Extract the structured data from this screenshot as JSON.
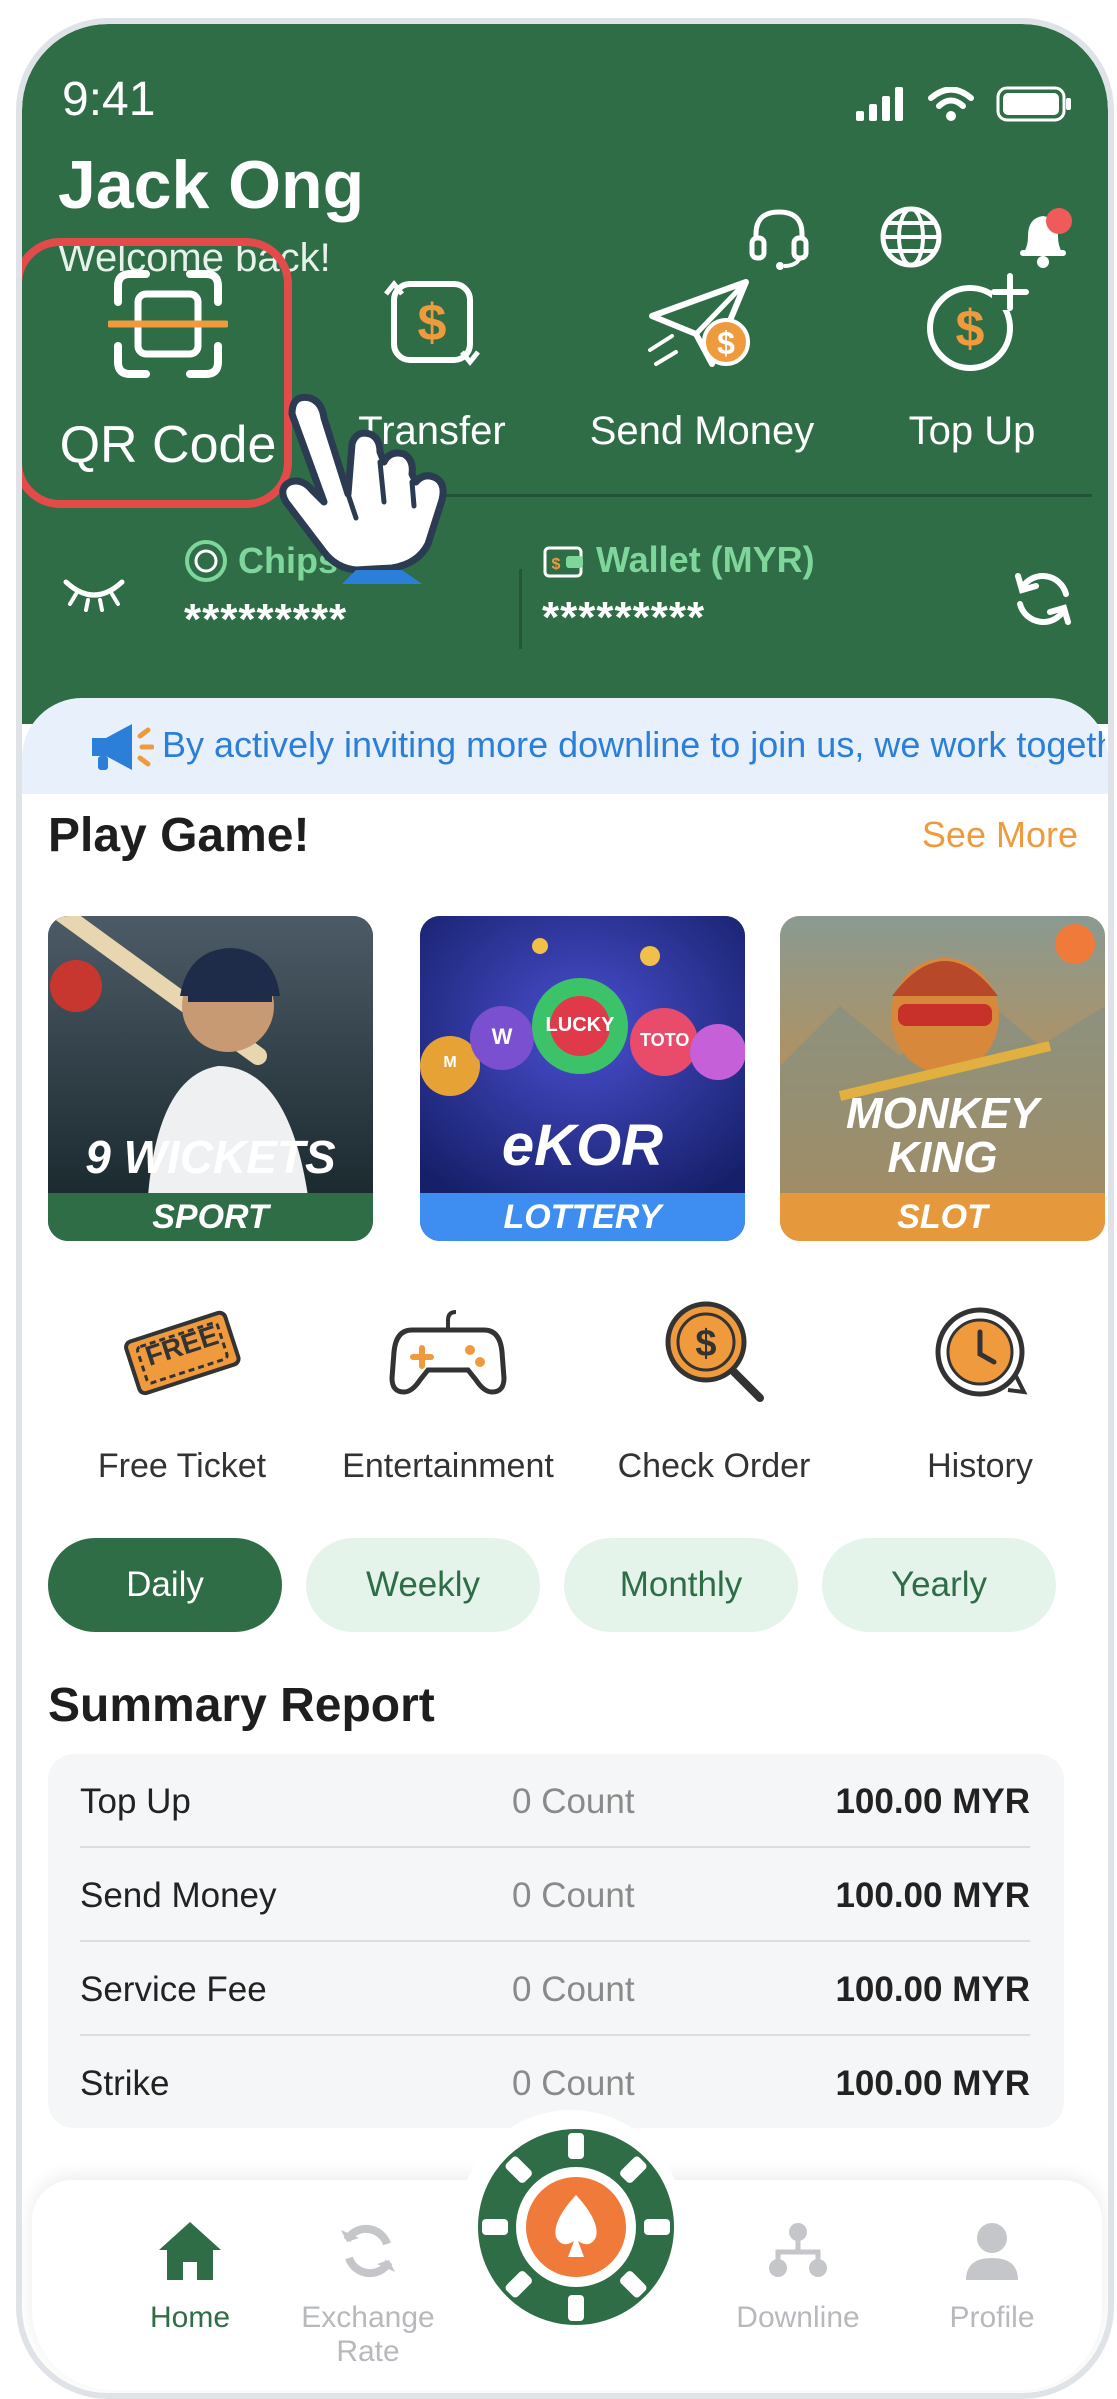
{
  "status": {
    "time": "9:41"
  },
  "user": {
    "name": "Jack Ong",
    "welcome": "Welcome back!"
  },
  "actions": [
    {
      "label": "QR Code",
      "icon": "qr-scan-icon"
    },
    {
      "label": "Transfer",
      "icon": "transfer-icon"
    },
    {
      "label": "Send Money",
      "icon": "send-money-icon"
    },
    {
      "label": "Top Up",
      "icon": "top-up-icon"
    }
  ],
  "balances": {
    "chips": {
      "label": "Chips",
      "value": "*********"
    },
    "wallet": {
      "label": "Wallet (MYR)",
      "value": "*********"
    }
  },
  "announcement": "By actively inviting more downline to join us, we work together",
  "play": {
    "title": "Play Game!",
    "see_more": "See More",
    "games": [
      {
        "name": "9 WICKETS",
        "category": "SPORT"
      },
      {
        "name": "eKOR",
        "category": "LOTTERY"
      },
      {
        "name": "MONKEY KING",
        "category": "SLOT"
      }
    ],
    "balls": [
      "M",
      "W",
      "LUCKY",
      "TOTO",
      ""
    ]
  },
  "tools": [
    {
      "label": "Free Ticket",
      "icon": "free-ticket-icon",
      "badge": "FREE"
    },
    {
      "label": "Entertainment",
      "icon": "gamepad-icon"
    },
    {
      "label": "Check Order",
      "icon": "check-order-icon"
    },
    {
      "label": "History",
      "icon": "history-icon"
    }
  ],
  "periods": [
    {
      "label": "Daily",
      "active": true
    },
    {
      "label": "Weekly",
      "active": false
    },
    {
      "label": "Monthly",
      "active": false
    },
    {
      "label": "Yearly",
      "active": false
    }
  ],
  "summary": {
    "title": "Summary Report",
    "rows": [
      {
        "name": "Top Up",
        "count": "0 Count",
        "amount": "100.00 MYR"
      },
      {
        "name": "Send Money",
        "count": "0 Count",
        "amount": "100.00 MYR"
      },
      {
        "name": "Service Fee",
        "count": "0 Count",
        "amount": "100.00 MYR"
      },
      {
        "name": "Strike",
        "count": "0 Count",
        "amount": "100.00 MYR"
      }
    ]
  },
  "nav": [
    {
      "label": "Home",
      "icon": "home-icon",
      "active": true
    },
    {
      "label": "Exchange Rate",
      "icon": "exchange-icon",
      "active": false
    },
    {
      "label": "Downline",
      "icon": "downline-icon",
      "active": false
    },
    {
      "label": "Profile",
      "icon": "profile-icon",
      "active": false
    }
  ],
  "colors": {
    "primary": "#2f6d47",
    "accent": "#f09a3e",
    "highlight": "#e34b4b",
    "link": "#2c7fd9"
  }
}
